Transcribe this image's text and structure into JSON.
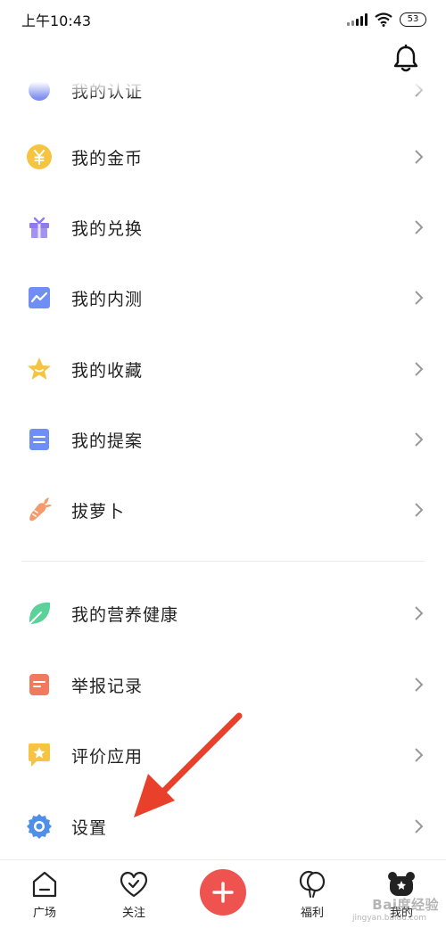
{
  "status_bar": {
    "time": "上午10:43",
    "battery": "53",
    "icons": [
      "signal-icon",
      "wifi-icon",
      "battery-icon"
    ]
  },
  "header": {
    "notification_icon": "bell-icon"
  },
  "menu": {
    "partial_item": {
      "label": "我的认证",
      "icon": "badge-icon"
    },
    "group1": [
      {
        "label": "我的金币",
        "icon": "coin-icon",
        "color": "#f5c542"
      },
      {
        "label": "我的兑换",
        "icon": "gift-icon",
        "color": "#8f7af0"
      },
      {
        "label": "我的内测",
        "icon": "chart-icon",
        "color": "#6f8ff5"
      },
      {
        "label": "我的收藏",
        "icon": "star-icon",
        "color": "#f5c542"
      },
      {
        "label": "我的提案",
        "icon": "document-icon",
        "color": "#6f8ff5"
      },
      {
        "label": "拔萝卜",
        "icon": "carrot-icon",
        "color": "#f59a6b"
      }
    ],
    "group2": [
      {
        "label": "我的营养健康",
        "icon": "leaf-icon",
        "color": "#5ad29a"
      },
      {
        "label": "举报记录",
        "icon": "report-icon",
        "color": "#f07a5e"
      },
      {
        "label": "评价应用",
        "icon": "rate-icon",
        "color": "#f5c542"
      },
      {
        "label": "设置",
        "icon": "gear-icon",
        "color": "#4f8fe8"
      }
    ]
  },
  "bottom_nav": {
    "items": [
      {
        "label": "广场",
        "icon": "home-icon"
      },
      {
        "label": "关注",
        "icon": "heart-icon"
      },
      {
        "label": "",
        "icon": "plus-icon"
      },
      {
        "label": "福利",
        "icon": "balloon-icon"
      },
      {
        "label": "我的",
        "icon": "profile-icon"
      }
    ],
    "accent_color": "#ef5350"
  },
  "watermark": {
    "text": "Bai度经验",
    "sub": "jingyan.baidu.com"
  }
}
